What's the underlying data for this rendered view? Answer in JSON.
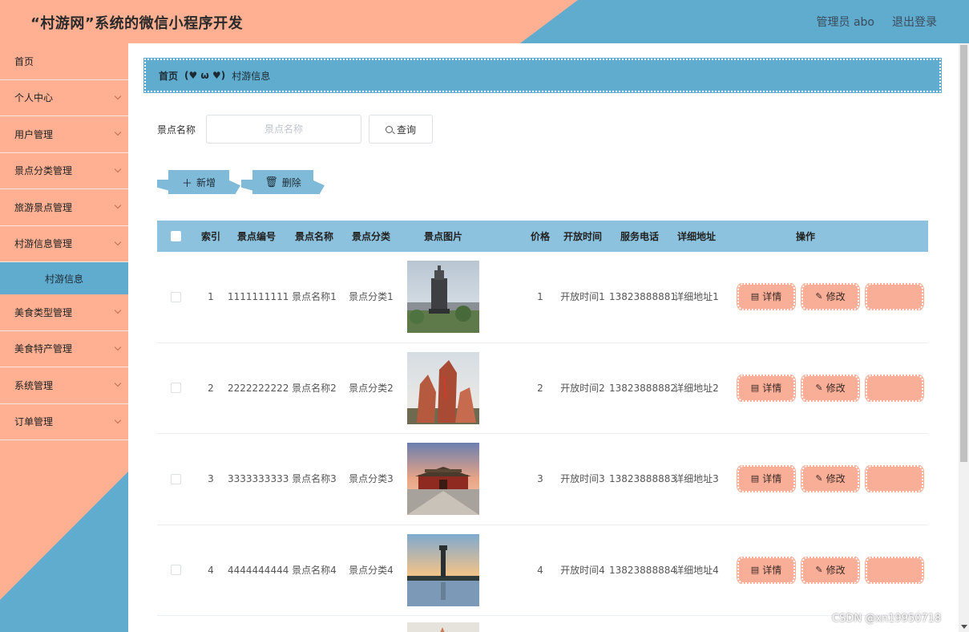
{
  "header": {
    "app_title": "“村游网”系统的微信小程序开发",
    "user_label": "管理员 abo",
    "logout_label": "退出登录"
  },
  "sidebar": {
    "items": [
      {
        "label": "首页"
      },
      {
        "label": "个人中心"
      },
      {
        "label": "用户管理"
      },
      {
        "label": "景点分类管理"
      },
      {
        "label": "旅游景点管理"
      },
      {
        "label": "村游信息管理"
      },
      {
        "label": "美食类型管理"
      },
      {
        "label": "美食特产管理"
      },
      {
        "label": "系统管理"
      },
      {
        "label": "订单管理"
      }
    ],
    "active_sub": "村游信息"
  },
  "breadcrumb": {
    "home": "首页",
    "separator": "(♥ ω ♥)",
    "current": "村游信息"
  },
  "search": {
    "label": "景点名称",
    "placeholder": "景点名称",
    "button": "查询"
  },
  "toolbar": {
    "add_label": "新增",
    "delete_label": "删除"
  },
  "table": {
    "headers": {
      "index": "索引",
      "code": "景点编号",
      "name": "景点名称",
      "category": "景点分类",
      "image": "景点图片",
      "price": "价格",
      "open_time": "开放时间",
      "phone": "服务电话",
      "address": "详细地址",
      "ops": "操作"
    },
    "rows": [
      {
        "index": "1",
        "code": "1111111111",
        "name": "景点名称1",
        "category": "景点分类1",
        "price": "1",
        "open_time": "开放时间1",
        "phone": "13823888881",
        "address": "详细地址1",
        "image_kind": "monument"
      },
      {
        "index": "2",
        "code": "2222222222",
        "name": "景点名称2",
        "category": "景点分类2",
        "price": "2",
        "open_time": "开放时间2",
        "phone": "13823888882",
        "address": "详细地址2",
        "image_kind": "rocks"
      },
      {
        "index": "3",
        "code": "3333333333",
        "name": "景点名称3",
        "category": "景点分类3",
        "price": "3",
        "open_time": "开放时间3",
        "phone": "13823888883",
        "address": "详细地址3",
        "image_kind": "gate"
      },
      {
        "index": "4",
        "code": "4444444444",
        "name": "景点名称4",
        "category": "景点分类4",
        "price": "4",
        "open_time": "开放时间4",
        "phone": "13823888884",
        "address": "详细地址4",
        "image_kind": "tower"
      }
    ],
    "op_labels": {
      "detail": "详情",
      "edit": "修改"
    }
  },
  "watermark": "CSDN @xn19950718",
  "colors": {
    "salmon": "#ffb093",
    "blue": "#5faccf",
    "header_row": "#8cc2dd",
    "op_button": "#f9ae98"
  }
}
